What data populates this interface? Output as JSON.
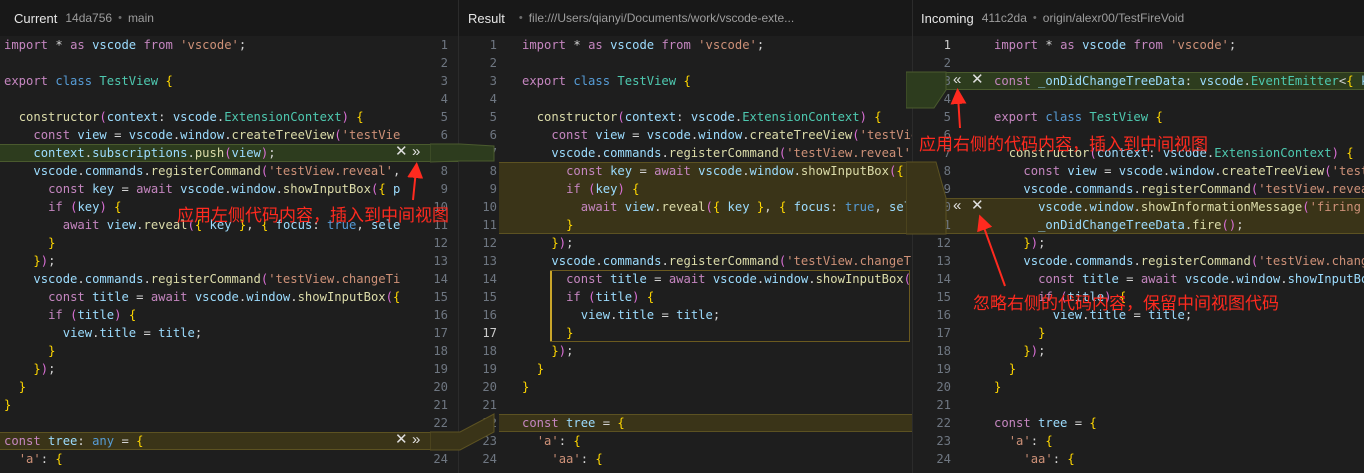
{
  "current": {
    "title": "Current",
    "commit": "14da756",
    "branch": "main"
  },
  "result": {
    "title": "Result",
    "path": "file:///Users/qianyi/Documents/work/vscode-exte..."
  },
  "incoming": {
    "title": "Incoming",
    "commit": "411c2da",
    "branch": "origin/alexr00/TestFireVoid"
  },
  "buttons": {
    "ignore": "✕",
    "accept_left": "»",
    "accept_right": "«"
  },
  "annotations": {
    "apply_left": "应用左侧代码内容，插入到中间视图",
    "apply_right": "应用右侧的代码内容，插入到中间视图",
    "ignore_right": "忽略右侧的代码内容，保留中间视图代码"
  },
  "current_lines": [
    "import * as vscode from 'vscode';",
    "",
    "export class TestView {",
    "",
    "  constructor(context: vscode.ExtensionContext) {",
    "    const view = vscode.window.createTreeView('testVie",
    "    context.subscriptions.push(view);",
    "    vscode.commands.registerCommand('testView.reveal',",
    "      const key = await vscode.window.showInputBox({ p",
    "      if (key) {",
    "        await view.reveal({ key }, { focus: true, sele",
    "      }",
    "    });",
    "    vscode.commands.registerCommand('testView.changeTi",
    "      const title = await vscode.window.showInputBox({",
    "      if (title) {",
    "        view.title = title;",
    "      }",
    "    });",
    "  }",
    "}",
    "",
    "const tree: any = {",
    "  'a': {"
  ],
  "result_lines": [
    "import * as vscode from 'vscode';",
    "",
    "export class TestView {",
    "",
    "  constructor(context: vscode.ExtensionContext) {",
    "    const view = vscode.window.createTreeView('testVie",
    "    vscode.commands.registerCommand('testView.reveal',",
    "      const key = await vscode.window.showInputBox({ p",
    "      if (key) {",
    "        await view.reveal({ key }, { focus: true, sele",
    "      }",
    "    });",
    "    vscode.commands.registerCommand('testView.changeTi",
    "      const title = await vscode.window.showInputBox({",
    "      if (title) {",
    "        view.title = title;",
    "      }",
    "    });",
    "  }",
    "}",
    "",
    "const tree = {",
    "  'a': {",
    "    'aa': {"
  ],
  "result_numbers": [
    "1",
    "2",
    "3",
    "4",
    "5",
    "6",
    "7",
    "8",
    "9",
    "10",
    "11",
    "12",
    "13",
    "14",
    "15",
    "16",
    "17",
    "18",
    "19",
    "20",
    "21",
    "22",
    "23",
    "24"
  ],
  "left_numbers": [
    "1",
    "2",
    "3",
    "4",
    "5",
    "6",
    "7",
    "8",
    "9",
    "10",
    "11",
    "12",
    "13",
    "14",
    "15",
    "16",
    "17",
    "18",
    "19",
    "20",
    "21",
    "22",
    "23",
    "24"
  ],
  "incoming_numbers": [
    "1",
    "2",
    "3",
    "4",
    "5",
    "6",
    "7",
    "8",
    "9",
    "10",
    "11",
    "12",
    "13",
    "14",
    "15",
    "16",
    "17",
    "18",
    "19",
    "20",
    "21",
    "22",
    "23",
    "24"
  ],
  "incoming_lines": [
    "import * as vscode from 'vscode';",
    "",
    "const _onDidChangeTreeData: vscode.EventEmitter<{ ke",
    "",
    "export class TestView {",
    "",
    "  constructor(context: vscode.ExtensionContext) {",
    "    const view = vscode.window.createTreeView('testVi",
    "    vscode.commands.registerCommand('testView.revea",
    "      vscode.window.showInformationMessage('firing'",
    "      _onDidChangeTreeData.fire();",
    "    });",
    "    vscode.commands.registerCommand('testView.change",
    "      const title = await vscode.window.showInputBox",
    "      if (title) {",
    "        view.title = title;",
    "      }",
    "    });",
    "  }",
    "}",
    "",
    "const tree = {",
    "  'a': {",
    "    'aa': {"
  ]
}
